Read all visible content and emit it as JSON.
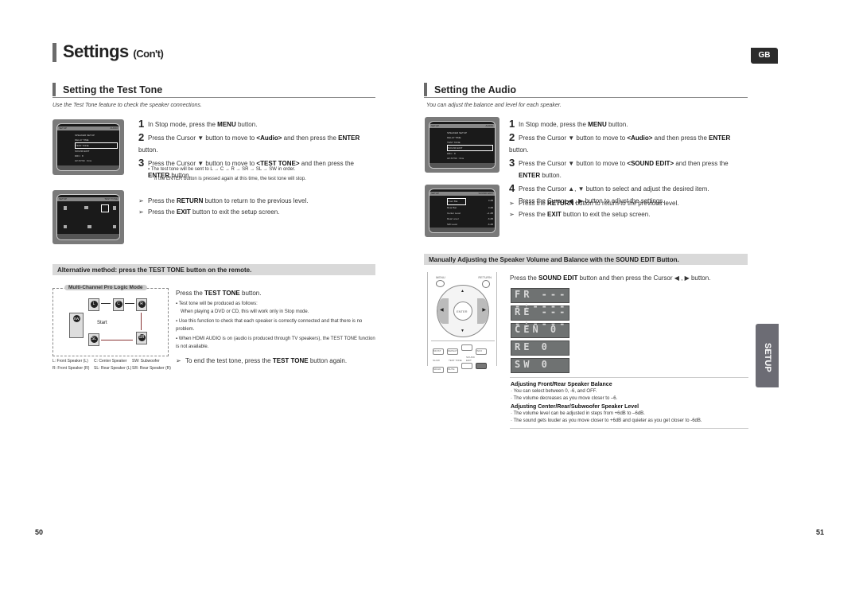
{
  "header": {
    "title": "Settings",
    "title_suffix": "(Con't)",
    "language_tab": "GB",
    "section_tab": "SETUP"
  },
  "left": {
    "section_title": "Setting the Test Tone",
    "intro": "Use the Test Tone feature to check the speaker connections.",
    "steps": [
      {
        "num": "1",
        "pre": "In Stop mode, press the ",
        "bold": "MENU",
        "post": " button."
      },
      {
        "num": "2",
        "pre": "Press the Cursor ▼ button to move to ",
        "bold": "<Audio>",
        "mid": " and then press the ",
        "bold2": "ENTER",
        "post": " button."
      },
      {
        "num": "3",
        "pre": "Press the Cursor ▼ button to move to ",
        "bold": "<TEST TONE>",
        "post": " and then press the",
        "line2_bold": "ENTER",
        "line2_post": " button."
      }
    ],
    "notes": [
      "The test tone will be sent to L → C → R → SR → SL → SW in order.",
      "If the ENTER button is pressed again at this time, the test tone will stop."
    ],
    "tips": [
      {
        "pre": "Press the ",
        "bold": "RETURN",
        "post": " button to return to the previous level."
      },
      {
        "pre": "Press the ",
        "bold": "EXIT",
        "post": " button to exit the setup screen."
      }
    ],
    "menu_screen": {
      "header_left": "SETUP",
      "header_right": "AUDIO",
      "sidebar": [
        "Disc Menu",
        "Title Menu",
        "Audio",
        "Setup"
      ],
      "items": [
        "SPEAKER SETUP",
        "DELAY TIME",
        "TEST TONE",
        "SOUND EDIT",
        "DRC : 8",
        "AV-SYNC : 0ms"
      ],
      "footer": [
        "MOVE",
        "ENTER",
        "RETURN",
        "EXIT"
      ]
    },
    "tone_screen": {
      "header_left": "SETUP",
      "header_right": "TEST TONE",
      "footer": [
        "STOP",
        "EXIT"
      ]
    },
    "alt_banner": "Alternative method: press the TEST TONE button on the remote.",
    "diagram": {
      "title": "Multi-Channel Pro Logic Mode",
      "speakers": [
        "L",
        "C",
        "R",
        "SW",
        "SL",
        "SR"
      ],
      "start_label": "Start",
      "legend": [
        [
          "L: Front Speaker (L)",
          "C: Center Speaker",
          "SW: Subwoofer"
        ],
        [
          "R: Front Speaker (R)",
          "SL: Rear Speaker (L)",
          "SR: Rear Speaker (R)"
        ]
      ]
    },
    "alt_instruction": {
      "pre": "Press the ",
      "bold": "TEST TONE",
      "post": " button."
    },
    "alt_bullets": [
      "Test tone will be produced as follows:",
      "When playing a DVD or CD, this will work only in Stop mode.",
      "Use this function to check that each speaker is correctly connected and that there is no problem.",
      "When HDMI AUDIO is on (audio is produced through TV speakers), the TEST TONE function is not available."
    ],
    "alt_tip": {
      "pre": "To end the test tone, press the ",
      "bold": "TEST TONE",
      "post": " button again."
    },
    "page_number": "50"
  },
  "right": {
    "section_title": "Setting the Audio",
    "intro": "You can adjust the balance and level for each speaker.",
    "steps": [
      {
        "num": "1",
        "pre": "In Stop mode, press the ",
        "bold": "MENU",
        "post": " button."
      },
      {
        "num": "2",
        "pre": "Press the Cursor ▼ button to move to ",
        "bold": "<Audio>",
        "mid": " and then press the ",
        "bold2": "ENTER",
        "post": " button."
      },
      {
        "num": "3",
        "pre": "Press the Cursor ▼ button to move to ",
        "bold": "<SOUND EDIT>",
        "post": " and then press the",
        "line2_bold": "ENTER",
        "line2_post": " button."
      },
      {
        "num": "4",
        "pre": "Press the Cursor ▲, ▼ button to select and adjust the desired item.",
        "line2": "Press the Cursor ◀ , ▶ button to adjust the settings."
      }
    ],
    "tips": [
      {
        "pre": "Press the ",
        "bold": "RETURN",
        "post": " button to return to the previous level."
      },
      {
        "pre": "Press the ",
        "bold": "EXIT",
        "post": " button to exit the setup screen."
      }
    ],
    "menu_screen": {
      "header_left": "SETUP",
      "header_right": "AUDIO",
      "items": [
        "SPEAKER SETUP",
        "DELAY TIME",
        "TEST TONE",
        "SOUND EDIT",
        "DRC : 8",
        "AV-SYNC : 0ms"
      ],
      "footer": [
        "MOVE",
        "ENTER",
        "RETURN",
        "EXIT"
      ]
    },
    "sound_edit_screen": {
      "header_left": "SETUP",
      "header_right": "SOUND EDIT",
      "rows": [
        {
          "label": "Front Bal.",
          "value": "0 dB"
        },
        {
          "label": "Rear Bal.",
          "value": "0 dB"
        },
        {
          "label": "Center Level",
          "value": "+1 dB"
        },
        {
          "label": "Rear Level",
          "value": "-6 dB"
        },
        {
          "label": "SW Level",
          "value": "-6 dB"
        }
      ],
      "footer": [
        "MOVE",
        "CHANGE",
        "RETURN",
        "EXIT"
      ]
    },
    "manual_banner": "Manually Adjusting the Speaker Volume and Balance with the SOUND EDIT Button.",
    "manual_instruction": {
      "pre": "Press the ",
      "bold": "SOUND EDIT",
      "post": " button and then press the Cursor ◀ , ▶ button."
    },
    "remote": {
      "menu": "MENU",
      "return": "RETURN",
      "enter": "ENTER",
      "buttons": [
        "MO/ST",
        "REPEAT",
        "INFO",
        "SLOW",
        "TEST TONE",
        "SOUND EDIT",
        "SD/HD",
        "MUTE"
      ]
    },
    "lcd_displays": [
      "FR ----:----",
      "RE ----:----",
      "CEN  0",
      "RE    0",
      "SW    0"
    ],
    "notes": {
      "balance_title": "Adjusting Front/Rear Speaker Balance",
      "balance_items": [
        "You can select between 0, -6, and OFF.",
        "The volume decreases as you move closer to –6."
      ],
      "level_title": "Adjusting Center/Rear/Subwoofer Speaker Level",
      "level_items": [
        "The volume level can be adjusted in steps from +6dB to –6dB.",
        "The sound gets louder as you move closer to +6dB and quieter as you get closer to -6dB."
      ]
    },
    "page_number": "51"
  }
}
